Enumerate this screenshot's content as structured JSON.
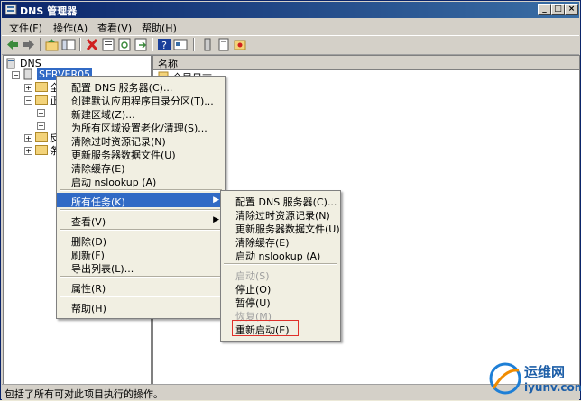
{
  "window": {
    "title": "DNS 管理器"
  },
  "menubar": {
    "file": "文件(F)",
    "action": "操作(A)",
    "view": "查看(V)",
    "help": "帮助(H)"
  },
  "tree": {
    "root": "DNS",
    "server": "SERVER05",
    "child1": "全",
    "child2": "正",
    "child5": "反",
    "child6": "条"
  },
  "list": {
    "column_name": "名称",
    "row1": "全局日志"
  },
  "context_menu": {
    "configure_dns": "配置 DNS 服务器(C)...",
    "create_default_partition": "创建默认应用程序目录分区(T)...",
    "new_zone": "新建区域(Z)...",
    "set_aging": "为所有区域设置老化/清理(S)...",
    "scavenge": "清除过时资源记录(N)",
    "update_data_files": "更新服务器数据文件(U)",
    "clear_cache": "清除缓存(E)",
    "launch_nslookup": "启动 nslookup (A)",
    "all_tasks": "所有任务(K)",
    "view": "查看(V)",
    "delete": "删除(D)",
    "refresh": "刷新(F)",
    "export_list": "导出列表(L)...",
    "properties": "属性(R)",
    "help": "帮助(H)"
  },
  "submenu": {
    "configure_dns": "配置 DNS 服务器(C)...",
    "scavenge": "清除过时资源记录(N)",
    "update_data_files": "更新服务器数据文件(U)",
    "clear_cache": "清除缓存(E)",
    "launch_nslookup": "启动 nslookup (A)",
    "start": "启动(S)",
    "stop": "停止(O)",
    "pause": "暂停(U)",
    "resume": "恢复(M)",
    "restart": "重新启动(E)"
  },
  "statusbar": {
    "text": "包括了所有可对此项目执行的操作。"
  },
  "watermark": {
    "text": "运维网",
    "url": "iyunv.com"
  },
  "colors": {
    "title_start": "#0a246a",
    "title_end": "#3a6ea5",
    "highlight": "#316ac5",
    "red_box": "#e0302a"
  }
}
